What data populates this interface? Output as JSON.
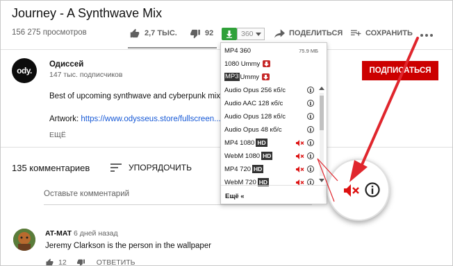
{
  "video": {
    "title": "Journey - A Synthwave Mix",
    "views": "156 275 просмотров"
  },
  "actions": {
    "likes": "2,7 ТЫС.",
    "dislikes": "92",
    "quality": "360",
    "share": "ПОДЕЛИТЬСЯ",
    "save": "СОХРАНИТЬ",
    "more": "..."
  },
  "channel": {
    "avatar_text": "ody.",
    "name": "Одиссей",
    "subscribers": "147 тыс. подписчиков",
    "subscribe_label": "ПОДПИСАТЬСЯ"
  },
  "description": {
    "line1": "Best of upcoming synthwave and cyberpunk mix.",
    "artwork_label": "Artwork: ",
    "artwork_link": "https://www.odysseus.store/fullscreen...",
    "more": "ЕЩЁ"
  },
  "comments": {
    "count": "135 комментариев",
    "sort_label": "УПОРЯДОЧИТЬ",
    "input_placeholder": "Оставьте комментарий",
    "items": [
      {
        "author": "AT-MAT",
        "time": "6 дней назад",
        "text": "Jeremy Clarkson is the person in the wallpaper",
        "likes": "12",
        "reply": "ОТВЕТИТЬ"
      }
    ]
  },
  "dropdown": {
    "items": [
      {
        "label": "MP4 360",
        "size": "75.9 МБ"
      },
      {
        "label": "1080 Ummy"
      },
      {
        "badge": "MP3",
        "label": " Ummy"
      },
      {
        "label": "Audio Opus 256 кб/с"
      },
      {
        "label": "Audio AAC 128 кб/с"
      },
      {
        "label": "Audio Opus 128 кб/с"
      },
      {
        "label": "Audio Opus 48 кб/с"
      },
      {
        "label": "MP4 1080",
        "badge": "HD"
      },
      {
        "label": "WebM 1080",
        "badge": "HD"
      },
      {
        "label": "MP4 720",
        "badge": "HD"
      },
      {
        "label": "WebM 720",
        "badge": "HD"
      }
    ],
    "more": "Ещё «"
  },
  "colors": {
    "accent_red": "#cc0000",
    "download_green": "#30a13a",
    "annotation_arrow": "#e0262d",
    "link_blue": "#1558d6"
  }
}
